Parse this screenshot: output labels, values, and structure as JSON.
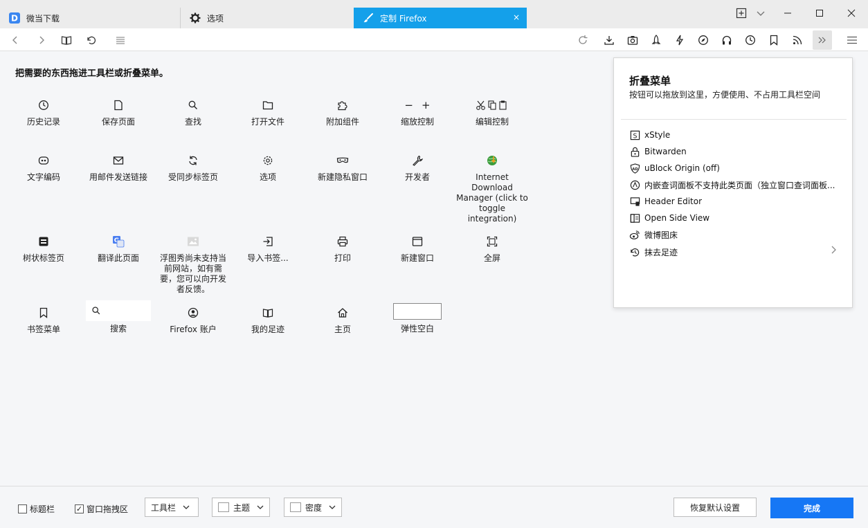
{
  "tabs": [
    {
      "label": "微当下载"
    },
    {
      "label": "选项"
    },
    {
      "label": "定制 Firefox",
      "close": "×"
    }
  ],
  "customize": {
    "heading": "把需要的东西拖进工具栏或折叠菜单。",
    "row1": [
      "历史记录",
      "保存页面",
      "查找",
      "打开文件",
      "附加组件",
      "缩放控制",
      "编辑控制"
    ],
    "row2": [
      "文字编码",
      "用邮件发送链接",
      "受同步标签页",
      "选项",
      "新建隐私窗口",
      "开发者",
      "Internet Download Manager (click to toggle integration)"
    ],
    "row3": [
      "树状标签页",
      "翻译此页面",
      "浮图秀尚未支持当前网站，如有需要，您可以向开发者反馈。",
      "导入书签...",
      "打印",
      "新建窗口",
      "全屏"
    ],
    "row4": [
      "书签菜单",
      "搜索",
      "Firefox 账户",
      "我的足迹",
      "主页",
      "弹性空白"
    ],
    "zoom_minus": "−",
    "zoom_plus": "+"
  },
  "panel": {
    "title": "折叠菜单",
    "desc": "按钮可以拖放到这里，方便使用、不占用工具栏空间",
    "items": [
      {
        "label": "xStyle",
        "icon": "xstyle-icon"
      },
      {
        "label": "Bitwarden",
        "icon": "bitwarden-icon"
      },
      {
        "label": "uBlock Origin (off)",
        "icon": "ublock-icon"
      },
      {
        "label": "内嵌查词面板不支持此类页面（独立窗口查词面板...",
        "icon": "dictionary-icon"
      },
      {
        "label": "Header Editor",
        "icon": "header-editor-icon"
      },
      {
        "label": "Open Side View",
        "icon": "side-view-icon"
      },
      {
        "label": "微博图床",
        "icon": "weibo-icon"
      },
      {
        "label": "抹去足迹",
        "icon": "forget-icon"
      }
    ]
  },
  "footer": {
    "titlebar_label": "标题栏",
    "drag_label": "窗口拖拽区",
    "toolbar_dd": "工具栏",
    "theme_dd": "主题",
    "density_dd": "密度",
    "reset_label": "恢复默认设置",
    "done_label": "完成"
  },
  "colors": {
    "accent": "#14a0ea",
    "done": "#1677f5"
  }
}
